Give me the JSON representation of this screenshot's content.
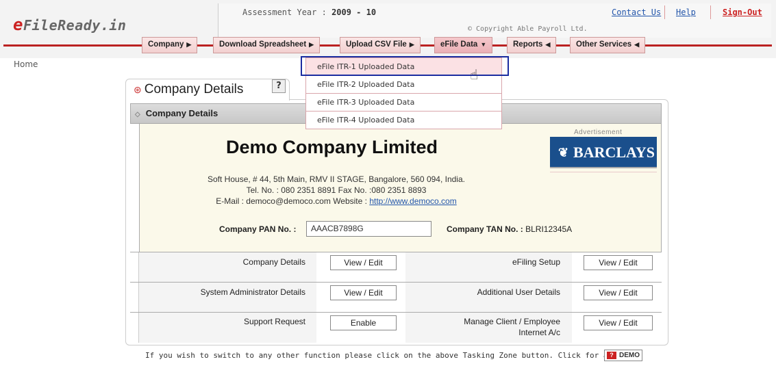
{
  "header": {
    "logo_e": "e",
    "logo_rest": "FileReady.in",
    "assessment_label": "Assessment Year :",
    "assessment_value": "2009 - 10",
    "copyright": "© Copyright Able Payroll Ltd.",
    "links": {
      "contact": "Contact Us",
      "help": "Help",
      "signout": "Sign-Out"
    }
  },
  "menu": [
    {
      "label": "Company",
      "arrow": "▶"
    },
    {
      "label": "Download Spreadsheet",
      "arrow": "▶"
    },
    {
      "label": "Upload CSV File",
      "arrow": "▶"
    },
    {
      "label": "eFile Data",
      "arrow": "▼"
    },
    {
      "label": "Reports",
      "arrow": "◀"
    },
    {
      "label": "Other Services",
      "arrow": "◀"
    }
  ],
  "dropdown": [
    "eFile ITR-1 Uploaded Data",
    "eFile ITR-2 Uploaded Data",
    "eFile ITR-3 Uploaded Data",
    "eFile ITR-4 Uploaded Data"
  ],
  "breadcrumb": "Home",
  "panel": {
    "tab_title": "Company Details",
    "help": "?",
    "header_title": "Company Details",
    "company_name": "Demo Company Limited",
    "address_line1": "Soft House, # 44, 5th Main, RMV II STAGE, Bangalore, 560 094, India.",
    "address_line2": "Tel. No. : 080 2351 8891   Fax No. :080 2351 8893",
    "email_prefix": "E-Mail : democo@democo.com   Website : ",
    "website": "http://www.democo.com",
    "pan_label": "Company PAN No. :",
    "pan_value": "AAACB7898G",
    "tan_label": "Company TAN No. :",
    "tan_value": "BLRI12345A",
    "ad_label": "Advertisement",
    "ad_text": "BARCLAYS"
  },
  "rows": [
    {
      "left_label": "Company Details",
      "left_btn": "View / Edit",
      "right_label": "eFiling Setup",
      "right_btn": "View / Edit"
    },
    {
      "left_label": "System Administrator Details",
      "left_btn": "View / Edit",
      "right_label": "Additional User Details",
      "right_btn": "View / Edit"
    },
    {
      "left_label": "Support Request",
      "left_btn": "Enable",
      "right_label_1": "Manage Client / Employee",
      "right_label_2": "Internet A/c",
      "right_btn": "View / Edit"
    }
  ],
  "footer": {
    "note": "If you wish to switch to any other function please click on the above Tasking Zone button. Click for a",
    "demo": "DEMO",
    "demo_icon": "?"
  }
}
